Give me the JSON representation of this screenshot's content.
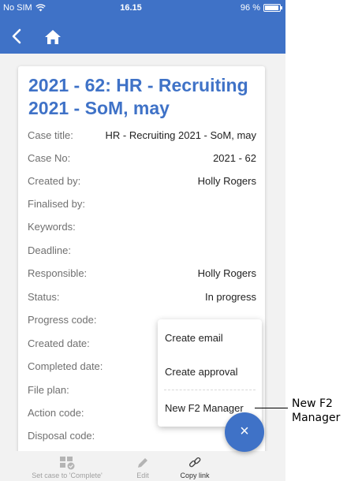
{
  "statusbar": {
    "carrier": "No SIM",
    "time": "16.15",
    "battery": "96 %"
  },
  "case": {
    "title_line1": "2021 - 62: HR - Recruiting",
    "title_line2": "2021 - SoM, may",
    "fields": [
      {
        "label": "Case title:",
        "value": "HR - Recruiting 2021 - SoM, may"
      },
      {
        "label": "Case No:",
        "value": "2021 - 62"
      },
      {
        "label": "Created by:",
        "value": "Holly Rogers"
      },
      {
        "label": "Finalised by:",
        "value": ""
      },
      {
        "label": "Keywords:",
        "value": ""
      },
      {
        "label": "Deadline:",
        "value": ""
      },
      {
        "label": "Responsible:",
        "value": "Holly Rogers"
      },
      {
        "label": "Status:",
        "value": "In progress"
      },
      {
        "label": "Progress code:",
        "value": ""
      },
      {
        "label": "Created date:",
        "value": ""
      },
      {
        "label": "Completed date:",
        "value": ""
      },
      {
        "label": "File plan:",
        "value": ""
      },
      {
        "label": "Action code:",
        "value": ""
      },
      {
        "label": "Disposal code:",
        "value": ""
      }
    ]
  },
  "menu": {
    "items": [
      "Create email",
      "Create approval",
      "New F2 Manager"
    ]
  },
  "bottombar": {
    "complete": "Set case to 'Complete'",
    "edit": "Edit",
    "copy_link": "Copy link"
  },
  "fab": {
    "icon": "close-icon",
    "symbol": "×"
  },
  "callout": {
    "text": "New F2 Manager"
  },
  "colors": {
    "accent": "#3f72c7",
    "background": "#f2f2f2",
    "label": "#707070"
  }
}
